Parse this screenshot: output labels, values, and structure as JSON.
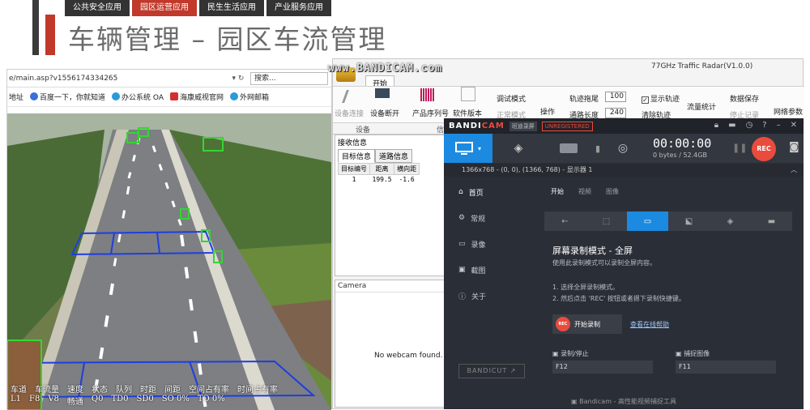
{
  "slide": {
    "categories": [
      "公共安全应用",
      "园区运营应用",
      "民生生活应用",
      "产业服务应用"
    ],
    "title": "车辆管理 – 园区车流管理"
  },
  "browser": {
    "address": "e/main.asp?v1556174334265",
    "nav_controls": "▾ ↻",
    "search_placeholder": "搜索...",
    "bookmarks": [
      "地址",
      "百度一下，你就知道",
      "办公系统 OA",
      "海康威视官网",
      "外网邮箱"
    ],
    "stats_header": [
      "车道",
      "车流量",
      "速度",
      "状态",
      "队列",
      "时距",
      "间距",
      "空间占有率",
      "时间占有率"
    ],
    "stats_values": [
      "L1",
      "F8",
      "V8",
      "畅通",
      "Q0",
      "TD0",
      "SD0",
      "SO 0%",
      "TO 0%"
    ]
  },
  "radar": {
    "title": "77GHz Traffic Radar(V1.0.0)",
    "watermark": "www.BANDICAM.com",
    "tab": "开始",
    "ribbon": {
      "connect": "设备连接",
      "disconnect": "设备断开",
      "group_device": "设备",
      "serial": "产品序列号",
      "sw_version": "软件版本",
      "group_info": "信",
      "debug_mode": "调试模式",
      "normal_mode": "正常模式",
      "operate": "操作",
      "track_drag_label": "轨迹拖尾",
      "track_drag_value": "100",
      "road_len_label": "通路长度",
      "road_len_value": "240",
      "show_track": "显示轨迹",
      "clear_track": "清除轨迹",
      "flow_stats": "流量统计",
      "data_save": "数据保存",
      "stop_record": "停止记录",
      "net_params": "网络参数"
    },
    "panel": {
      "title": "接收信息",
      "tabs": [
        "目标信息",
        "道路信息"
      ],
      "columns": [
        "目标编号",
        "距离",
        "横向距"
      ],
      "rows": [
        [
          "1",
          "199.5",
          "-1.6"
        ]
      ]
    },
    "camera": {
      "title": "Camera",
      "message": "No webcam found. Ch"
    }
  },
  "bandicam": {
    "brand_white": "BANDI",
    "brand_red": "CAM",
    "chip": "班迪录屏",
    "unreg": "UNREGISTERED",
    "timer": "00:00:00",
    "size": "0 bytes / 52.4GB",
    "rec": "REC",
    "resolution": "1366x768 - (0, 0), (1366, 768) - 显示器 1",
    "sidebar": [
      "首页",
      "常规",
      "录像",
      "截图",
      "关于"
    ],
    "bandicut": "BANDICUT ↗",
    "tabs": [
      "开始",
      "视频",
      "图像"
    ],
    "heading": "屏幕录制模式 - 全屏",
    "desc": "使用此录制模式可以录制全屏内容。",
    "step1": "1. 选择全屏录制模式。",
    "step2": "2. 然后点击 'REC' 按钮或者摁下录制快捷键。",
    "start_rec": "开始录制",
    "rec_dot": "REC",
    "help": "查看在线帮助",
    "hotkey1_label": "录制/停止",
    "hotkey1": "F12",
    "hotkey2_label": "捕捉图像",
    "hotkey2": "F11",
    "footer": "Bandicam - 高性能视频捕捉工具"
  }
}
